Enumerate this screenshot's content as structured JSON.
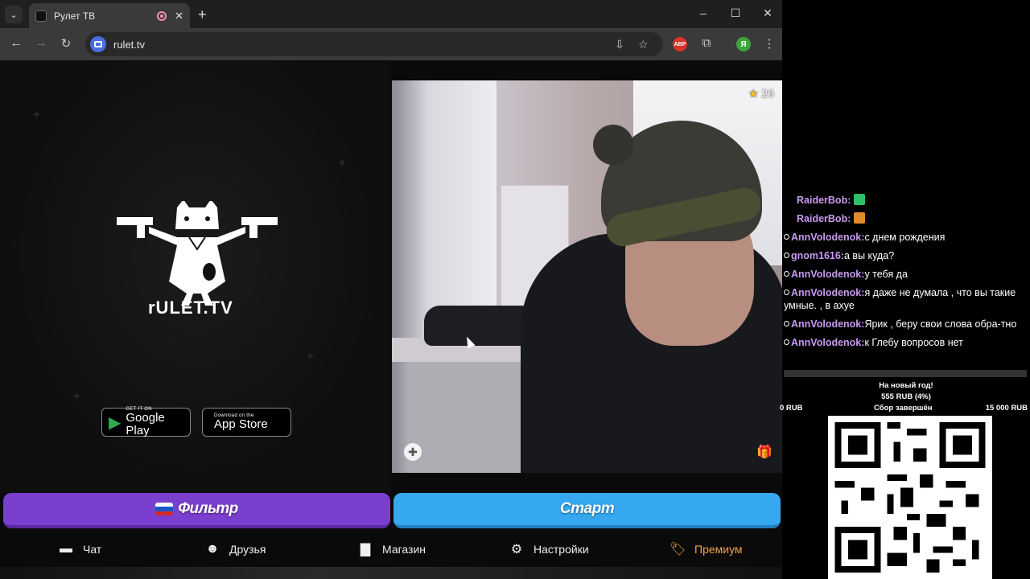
{
  "browser": {
    "tab_title": "Рулет ТВ",
    "url": "rulet.tv",
    "new_tab": "+",
    "tab_close": "✕",
    "profile_initial": "Я",
    "adblock_label": "ABP",
    "window_controls": [
      "–",
      "☐",
      "✕"
    ]
  },
  "page": {
    "logo_text": "rULET.TV",
    "google_play": {
      "small": "GET IT ON",
      "big": "Google Play"
    },
    "app_store": {
      "small": "Download on the",
      "big": "App Store"
    },
    "video": {
      "rating": "26"
    },
    "filter_button": "Фильтр",
    "start_button": "Старт",
    "nav": [
      {
        "label": "Чат",
        "icon": "chat-icon"
      },
      {
        "label": "Друзья",
        "icon": "friends-icon"
      },
      {
        "label": "Магазин",
        "icon": "shop-bag-icon"
      },
      {
        "label": "Настройки",
        "icon": "gear-icon"
      },
      {
        "label": "Премиум",
        "icon": "tag-icon"
      }
    ],
    "colors": {
      "filter": "#7b3fd0",
      "start": "#35a8f0",
      "premium": "#f0a24a",
      "username": "#c89af0"
    }
  },
  "chat": {
    "messages": [
      {
        "user": "RaiderBob:",
        "text": "",
        "emote": "green-emote"
      },
      {
        "user": "RaiderBob:",
        "text": "",
        "emote": "orange-emote"
      },
      {
        "user": "AnnVolodenok:",
        "text": "с днем рождения"
      },
      {
        "user": "gnom1616:",
        "text": "а вы куда?"
      },
      {
        "user": "AnnVolodenok:",
        "text": "у тебя да"
      },
      {
        "user": "AnnVolodenok:",
        "text": "я даже не думала , что вы такие умные. , в ахуе"
      },
      {
        "user": "AnnVolodenok:",
        "text": "Ярик , беру свои слова обра-тно"
      },
      {
        "user": "AnnVolodenok:",
        "text": "к Глебу вопросов нет"
      }
    ]
  },
  "goal": {
    "title": "На новый год!",
    "amount": "555 RUB (4%)",
    "min": "0 RUB",
    "status": "Сбор завершён",
    "max": "15 000 RUB"
  }
}
